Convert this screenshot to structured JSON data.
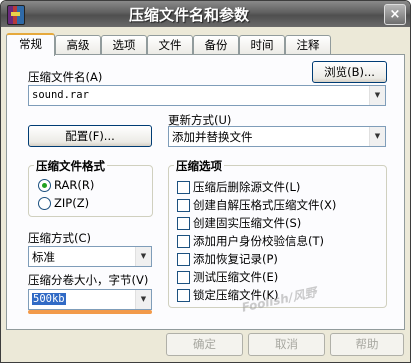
{
  "window": {
    "title": "压缩文件名和参数",
    "close": "×"
  },
  "tabs": [
    "常规",
    "高级",
    "选项",
    "文件",
    "备份",
    "时间",
    "注释"
  ],
  "archive_name": {
    "label": "压缩文件名(A)",
    "value": "sound.rar",
    "browse": "浏览(B)..."
  },
  "update_mode": {
    "label": "更新方式(U)",
    "value": "添加并替换文件"
  },
  "profiles_button": "配置(F)...",
  "format": {
    "title": "压缩文件格式",
    "options": [
      "RAR(R)",
      "ZIP(Z)"
    ],
    "selected": "RAR(R)"
  },
  "method": {
    "label": "压缩方式(C)",
    "value": "标准"
  },
  "volume": {
    "label": "压缩分卷大小，字节(V)",
    "value": "500kb"
  },
  "options": {
    "title": "压缩选项",
    "items": [
      "压缩后删除源文件(L)",
      "创建自解压格式压缩文件(X)",
      "创建固实压缩文件(S)",
      "添加用户身份校验信息(T)",
      "添加恢复记录(P)",
      "测试压缩文件(E)",
      "锁定压缩文件(K)"
    ]
  },
  "footer": {
    "ok": "确定",
    "cancel": "取消",
    "help": "帮助"
  },
  "watermark": "Foolish/风野",
  "colors": {
    "title_bar": "#5f5f5f",
    "active_tab_accent": "#e6a93c",
    "annotation_underline": "#f29a4a"
  }
}
